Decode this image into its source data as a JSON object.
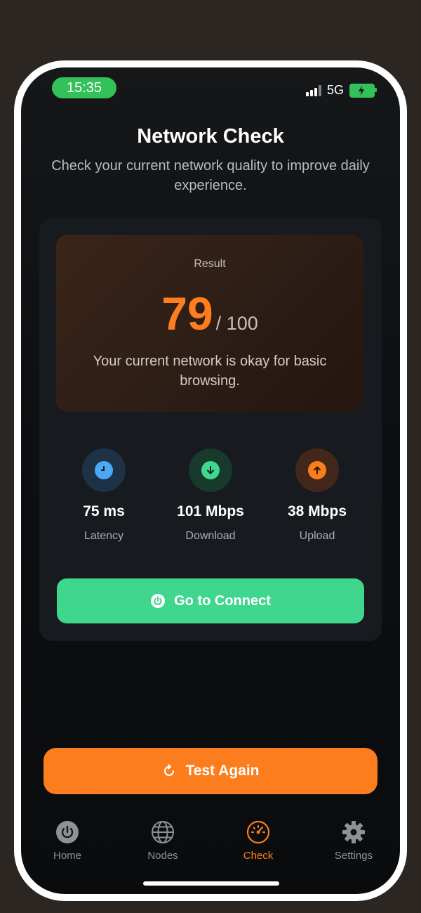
{
  "status_bar": {
    "time": "15:35",
    "network": "5G"
  },
  "header": {
    "title": "Network Check",
    "subtitle": "Check your current network quality to improve daily experience."
  },
  "result": {
    "label": "Result",
    "score": "79",
    "score_max": "/ 100",
    "description": "Your current network is okay for basic browsing."
  },
  "stats": [
    {
      "value": "75 ms",
      "label": "Latency",
      "icon": "clock-icon",
      "color": "#4aa8f5"
    },
    {
      "value": "101 Mbps",
      "label": "Download",
      "icon": "arrow-down-icon",
      "color": "#3fd68e"
    },
    {
      "value": "38 Mbps",
      "label": "Upload",
      "icon": "arrow-up-icon",
      "color": "#fb7d1d"
    }
  ],
  "connect_button": {
    "label": "Go to Connect",
    "icon": "power-icon"
  },
  "test_button": {
    "label": "Test Again",
    "icon": "refresh-icon"
  },
  "tabs": [
    {
      "label": "Home",
      "icon": "power-icon",
      "active": false
    },
    {
      "label": "Nodes",
      "icon": "globe-icon",
      "active": false
    },
    {
      "label": "Check",
      "icon": "speedometer-icon",
      "active": true
    },
    {
      "label": "Settings",
      "icon": "gear-icon",
      "active": false
    }
  ],
  "colors": {
    "accent": "#fb7d1d",
    "success": "#3fd68e",
    "info": "#4aa8f5",
    "background": "#0d0f12"
  }
}
